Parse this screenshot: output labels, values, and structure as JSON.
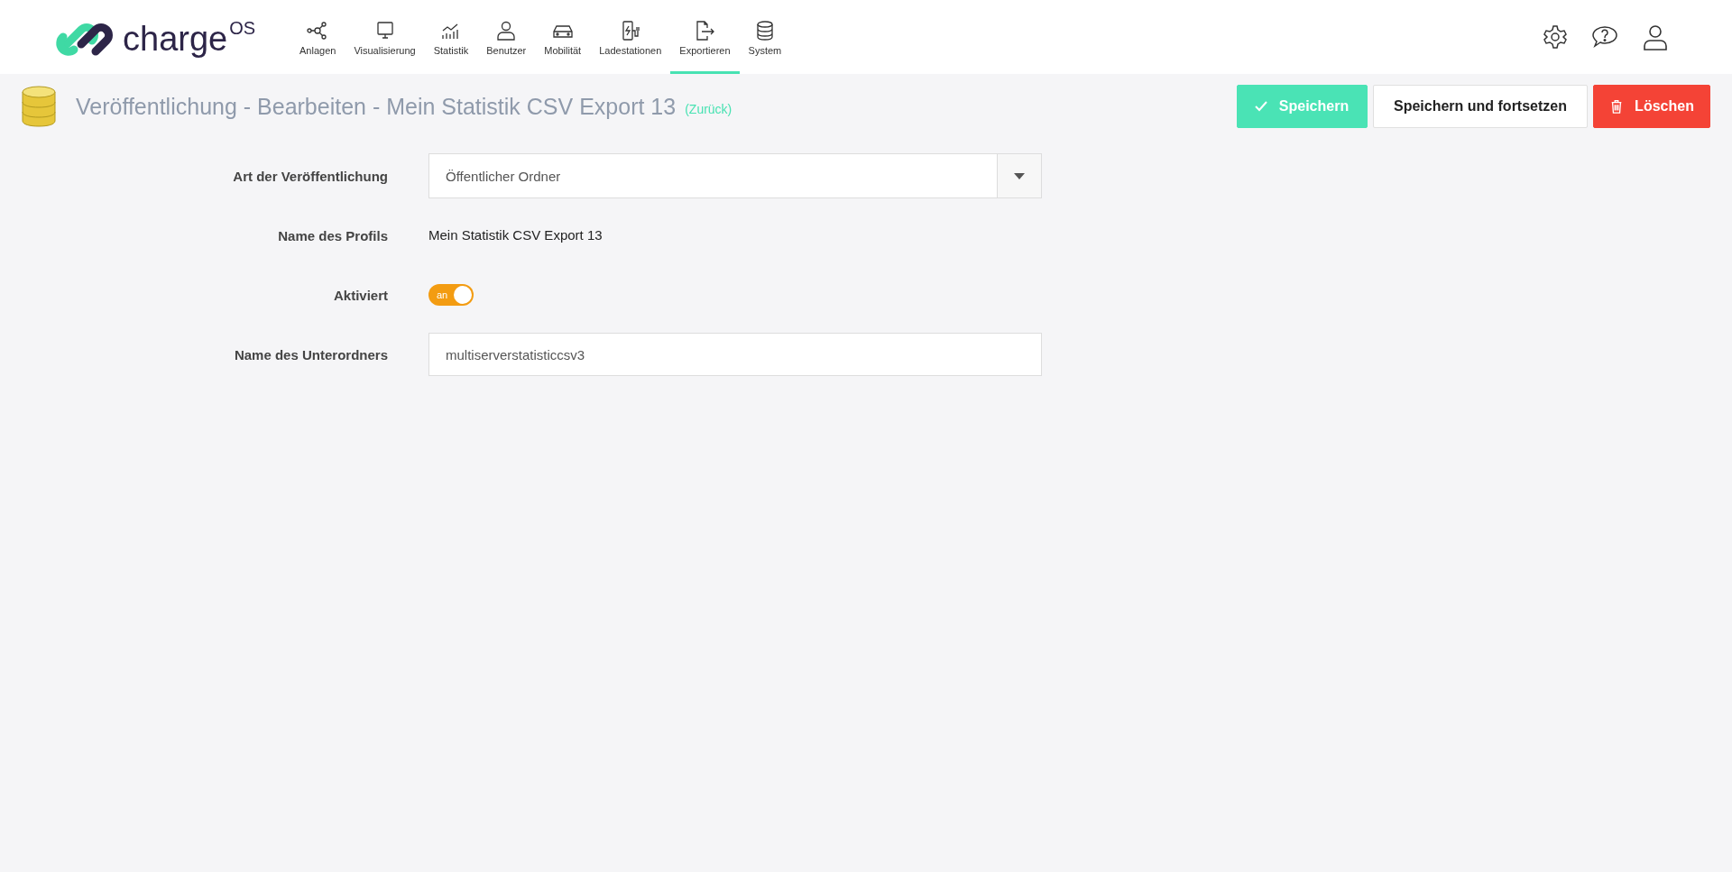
{
  "logo": {
    "name": "charge",
    "suffix": "OS"
  },
  "nav": [
    {
      "label": "Anlagen",
      "kind": "nodes",
      "selected": false
    },
    {
      "label": "Visualisierung",
      "kind": "monitor",
      "selected": false
    },
    {
      "label": "Statistik",
      "kind": "chart",
      "selected": false
    },
    {
      "label": "Benutzer",
      "kind": "user",
      "selected": false
    },
    {
      "label": "Mobilität",
      "kind": "car",
      "selected": false
    },
    {
      "label": "Ladestationen",
      "kind": "charger",
      "selected": false
    },
    {
      "label": "Exportieren",
      "kind": "export",
      "selected": true
    },
    {
      "label": "System",
      "kind": "database",
      "selected": false
    }
  ],
  "page": {
    "title": "Veröffentlichung - Bearbeiten - Mein Statistik CSV Export 13",
    "back_link": "(Zurück)"
  },
  "buttons": [
    {
      "label": "Speichern",
      "kind": "primary"
    },
    {
      "label": "Speichern und fortsetzen",
      "kind": "default"
    },
    {
      "label": "Löschen",
      "kind": "danger"
    }
  ],
  "form": [
    {
      "label": "Art der Veröffentlichung",
      "kind": "select",
      "value": "Öffentlicher Ordner"
    },
    {
      "label": "Name des Profils",
      "kind": "static",
      "value": "Mein Statistik CSV Export 13"
    },
    {
      "label": "Aktiviert",
      "kind": "toggle",
      "on": true,
      "value": "an"
    },
    {
      "label": "Name des Unterordners",
      "kind": "input",
      "value": "multiserverstatisticcsv3"
    }
  ]
}
